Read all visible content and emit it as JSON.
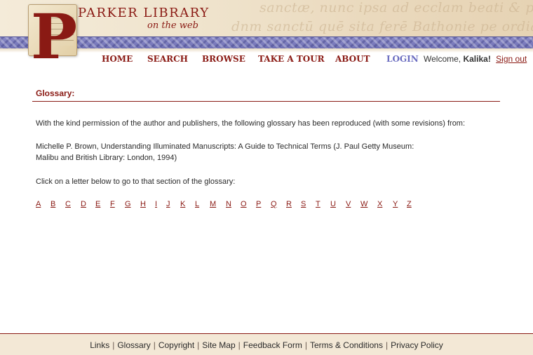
{
  "brand": {
    "title": "PARKER LIBRARY",
    "subtitle": "on the web",
    "logo_letter": "P",
    "background_script_line1": "sanctæ, nunc ipsa ad ecclam beati & pharti ecclaᵉ",
    "background_script_line2": "dnm sanctū quē sita ferē Bathonie pe ordiali"
  },
  "nav": [
    {
      "id": "home",
      "label": "HOME"
    },
    {
      "id": "search",
      "label": "SEARCH"
    },
    {
      "id": "browse",
      "label": "BROWSE"
    },
    {
      "id": "tour",
      "label": "TAKE A TOUR"
    },
    {
      "id": "about",
      "label": "ABOUT"
    },
    {
      "id": "login",
      "label": "LOGIN"
    }
  ],
  "user": {
    "welcome_prefix": "Welcome, ",
    "name": "Kalika!",
    "signout_label": "Sign out"
  },
  "page": {
    "title": "Glossary:",
    "intro": "With the kind permission of the author and publishers, the following glossary has been reproduced (with some revisions) from:",
    "citation_line1": "Michelle P. Brown, Understanding Illuminated Manuscripts: A Guide to Technical Terms (J. Paul Getty Museum:",
    "citation_line2": "Malibu and British Library: London, 1994)",
    "instruction": "Click on a letter below to go to that section of the glossary:",
    "letters": [
      "A",
      "B",
      "C",
      "D",
      "E",
      "F",
      "G",
      "H",
      "I",
      "J",
      "K",
      "L",
      "M",
      "N",
      "O",
      "P",
      "Q",
      "R",
      "S",
      "T",
      "U",
      "V",
      "W",
      "X",
      "Y",
      "Z"
    ]
  },
  "footer": {
    "links": [
      "Links",
      "Glossary",
      "Copyright",
      "Site Map",
      "Feedback Form",
      "Terms & Conditions",
      "Privacy Policy"
    ],
    "separator": "|"
  },
  "colors": {
    "accent": "#8a1a14",
    "login": "#6b6dc0",
    "band": "#7d7ebd",
    "footer_bg": "#f3e8d6"
  }
}
